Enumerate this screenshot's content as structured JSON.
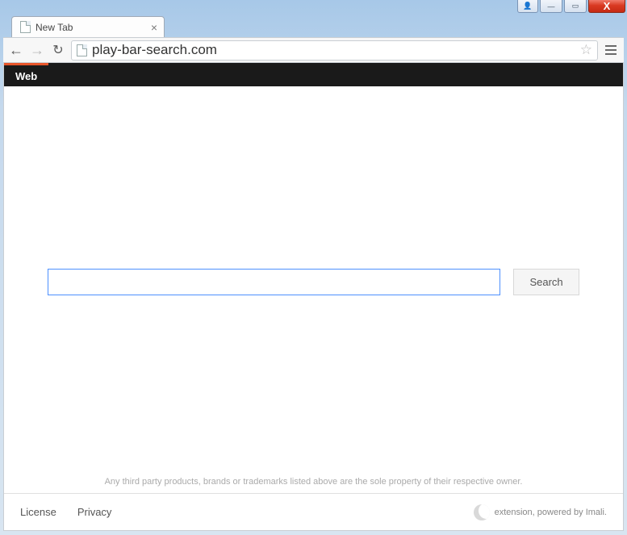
{
  "titlebar": {
    "user_icon": "👤",
    "minimize": "—",
    "maximize": "▭",
    "close": "X"
  },
  "tab": {
    "title": "New Tab",
    "close": "×"
  },
  "toolbar": {
    "back": "←",
    "forward": "→",
    "reload": "↻",
    "url": "play-bar-search.com",
    "star": "☆"
  },
  "blackbar": {
    "web_label": "Web"
  },
  "search": {
    "value": "",
    "button_label": "Search"
  },
  "disclaimer": "Any third party products, brands or trademarks listed above are the sole property of their respective owner.",
  "footer": {
    "license": "License",
    "privacy": "Privacy",
    "powered": "extension, powered by Imali."
  }
}
